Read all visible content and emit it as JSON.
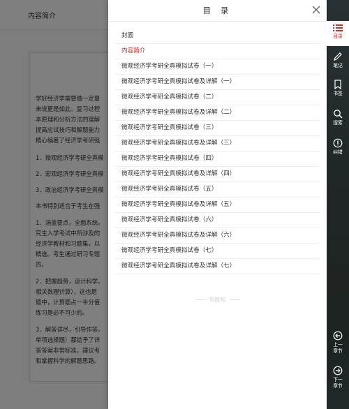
{
  "header": {
    "title": "内容简介"
  },
  "article": {
    "paragraphs": [
      "学好经济学需要做一定量",
      "来说更是如此。复习过程",
      "本原理和分析方法的理解",
      "提高应试技巧和解题能力",
      "精心编著了经济学考研强",
      "1．微观经济学考研全真模",
      "2．宏观经济学考研全真模",
      "3．政治经济学考研全真模",
      "本书特别适合于考生在强",
      "1．涵盖要点，全面系统。",
      "究生入学考试中所涉及的",
      "经济学教材和习题集，以",
      "精选。考生通过研习专题",
      "的。",
      "2．把握趋势，设计科学。",
      "相关数理计算），这也是",
      "题中，计算题占一半分值",
      "练习是必不可少的。",
      "3．解答详尽，引导作答。",
      "单项选择题）都给予了详",
      "答答案非常标准，建议考",
      "和掌握科学的解题思路。"
    ]
  },
  "toc": {
    "title": "目 录",
    "items": [
      {
        "label": "封面"
      },
      {
        "label": "内容简介"
      },
      {
        "label": "微观经济学考研全真模拟试卷（一）"
      },
      {
        "label": "微观经济学考研全真模拟试卷及详解（一）"
      },
      {
        "label": "微观经济学考研全真模拟试卷（二）"
      },
      {
        "label": "微观经济学考研全真模拟试卷及详解（二）"
      },
      {
        "label": "微观经济学考研全真模拟试卷（三）"
      },
      {
        "label": "微观经济学考研全真模拟试卷及详解（三）"
      },
      {
        "label": "微观经济学考研全真模拟试卷（四）"
      },
      {
        "label": "微观经济学考研全真模拟试卷及详解（四）"
      },
      {
        "label": "微观经济学考研全真模拟试卷（五）"
      },
      {
        "label": "微观经济学考研全真模拟试卷及详解（五）"
      },
      {
        "label": "微观经济学考研全真模拟试卷（六）"
      },
      {
        "label": "微观经济学考研全真模拟试卷及详解（六）"
      },
      {
        "label": "微观经济学考研全真模拟试卷（七）"
      },
      {
        "label": "微观经济学考研全真模拟试卷及详解（七）"
      }
    ],
    "active_index": 1,
    "end_text": "到底啦"
  },
  "sidebar": {
    "toc_label": "目录",
    "notes_label": "笔记",
    "bookmark_label": "书签",
    "search_label": "搜索",
    "report_label": "纠错",
    "prev_label": "上一章节",
    "next_label": "下一章节"
  },
  "colors": {
    "accent": "#c9302c",
    "sidebar_bg": "#141c1e"
  }
}
